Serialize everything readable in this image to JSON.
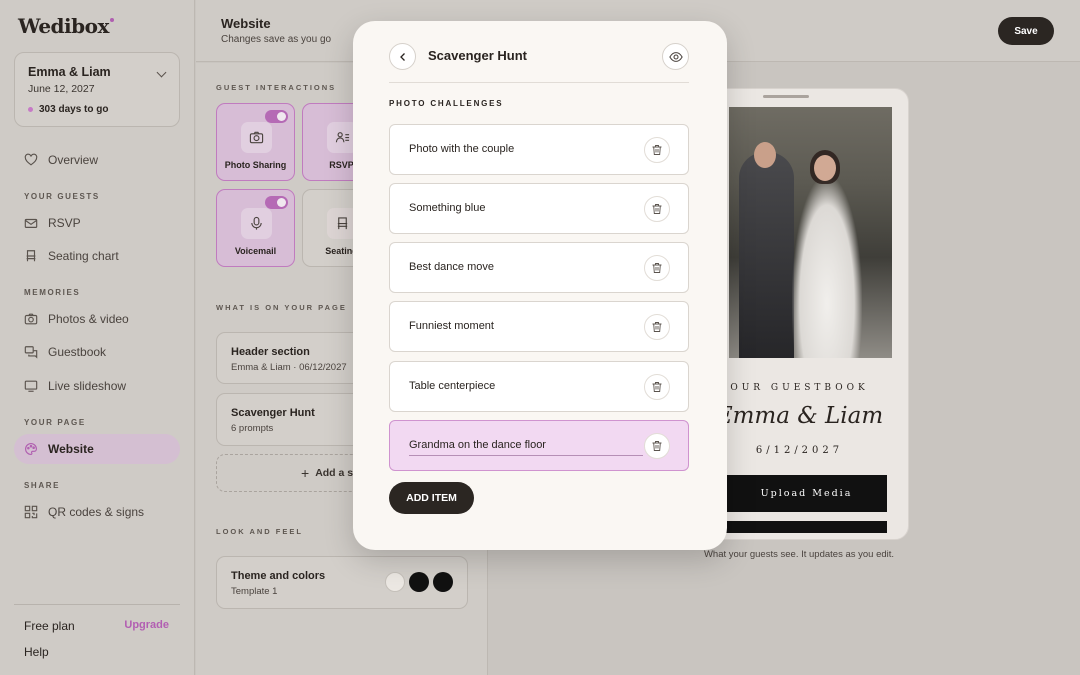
{
  "app": {
    "logo": "Wedibox"
  },
  "event": {
    "name": "Emma & Liam",
    "date": "June 12, 2027",
    "countdown": "303 days to go"
  },
  "sidebar": {
    "overview": "Overview",
    "section_guests": "YOUR GUESTS",
    "rsvp": "RSVP",
    "seating": "Seating chart",
    "section_memories": "MEMORIES",
    "photos": "Photos & video",
    "guestbook": "Guestbook",
    "slideshow": "Live slideshow",
    "section_page": "YOUR PAGE",
    "website": "Website",
    "section_share": "SHARE",
    "qr": "QR codes & signs",
    "plan": "Free plan",
    "upgrade": "Upgrade",
    "help": "Help"
  },
  "header": {
    "title": "Website",
    "subtitle": "Changes save as you go",
    "save": "Save"
  },
  "editor": {
    "section_interactions": "GUEST INTERACTIONS",
    "tiles": [
      {
        "label": "Photo Sharing",
        "on": true
      },
      {
        "label": "RSVP",
        "on": true
      },
      {
        "label": "Voicemail",
        "on": true
      },
      {
        "label": "Seating",
        "on": false
      }
    ],
    "section_page": "WHAT IS ON YOUR PAGE",
    "header_card": {
      "title": "Header section",
      "sub": "Emma & Liam · 06/12/2027"
    },
    "hunt_card": {
      "title": "Scavenger Hunt",
      "sub": "6 prompts"
    },
    "add_section": "Add a s",
    "section_look": "LOOK AND FEEL",
    "theme_card": {
      "title": "Theme and colors",
      "sub": "Template 1"
    },
    "swatches": [
      "#ece8e3",
      "#111111",
      "#111111"
    ]
  },
  "preview": {
    "guestbook_label": "OUR GUESTBOOK",
    "couple": "Emma & Liam",
    "date": "6/12/2027",
    "upload": "Upload Media",
    "caption": "What your guests see. It updates as you edit."
  },
  "modal": {
    "title": "Scavenger Hunt",
    "section": "PHOTO CHALLENGES",
    "items": [
      "Photo with the couple",
      "Something blue",
      "Best dance move",
      "Funniest moment",
      "Table centerpiece",
      "Grandma on the dance floor"
    ],
    "add_item": "ADD ITEM"
  }
}
